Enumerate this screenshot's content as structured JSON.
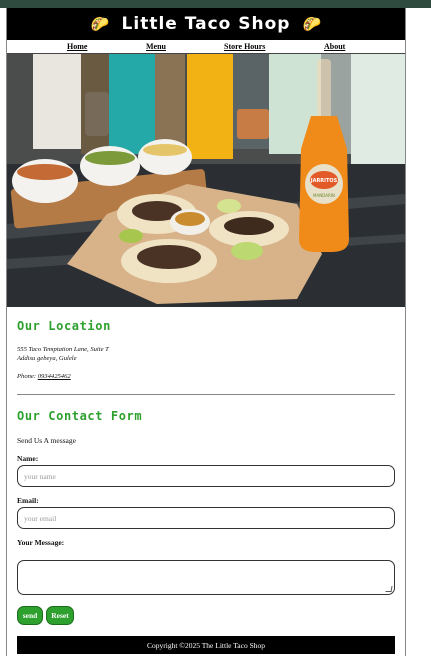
{
  "header": {
    "title": "Little Taco Shop",
    "left_icon": "taco-icon",
    "right_icon": "taco-icon"
  },
  "nav": {
    "items": [
      "Home",
      "Menu",
      "Store Hours",
      "About"
    ]
  },
  "hero": {
    "alt": "Tacos with bottle",
    "bottle_label": "JARRITOS",
    "bottle_flavor": "MANDARIN"
  },
  "location": {
    "title": "Our Location",
    "address_line1": "555 Taco Temptation Lane, Suite T",
    "address_line2": "Addisu gebeya, Gulele",
    "phone_label": "Phone: ",
    "phone": "0934425462"
  },
  "contact": {
    "title": "Our Contact Form",
    "subtitle": "Send Us A message",
    "name_label": "Name:",
    "name_placeholder": "your name",
    "email_label": "Email:",
    "email_placeholder": "your email",
    "message_label": "Your Message:",
    "send_label": "send",
    "reset_label": "Reset"
  },
  "footer": {
    "copyright": "Copyright ©2025 The Little Taco Shop"
  }
}
